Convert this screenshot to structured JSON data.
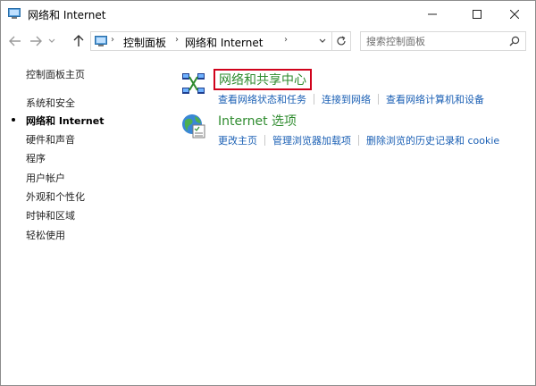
{
  "window": {
    "title": "网络和 Internet"
  },
  "address_bar": {
    "crumbs": [
      "控制面板",
      "网络和 Internet"
    ],
    "search_placeholder": "搜索控制面板"
  },
  "left_nav": {
    "items": [
      {
        "label": "控制面板主页",
        "active": false
      },
      {
        "label": "系统和安全",
        "active": false
      },
      {
        "label": "网络和 Internet",
        "active": true
      },
      {
        "label": "硬件和声音",
        "active": false
      },
      {
        "label": "程序",
        "active": false
      },
      {
        "label": "用户帐户",
        "active": false
      },
      {
        "label": "外观和个性化",
        "active": false
      },
      {
        "label": "时钟和区域",
        "active": false
      },
      {
        "label": "轻松使用",
        "active": false
      }
    ]
  },
  "sections": [
    {
      "title": "网络和共享中心",
      "icon": "network-sharing-center-icon",
      "highlighted": true,
      "links": [
        "查看网络状态和任务",
        "连接到网络",
        "查看网络计算机和设备"
      ]
    },
    {
      "title": "Internet 选项",
      "icon": "internet-options-icon",
      "highlighted": false,
      "links": [
        "更改主页",
        "管理浏览器加载项",
        "删除浏览的历史记录和 cookie"
      ]
    }
  ],
  "colors": {
    "section_title": "#2e8b2e",
    "link": "#1a5fb4",
    "highlight_border": "#d0021b"
  }
}
